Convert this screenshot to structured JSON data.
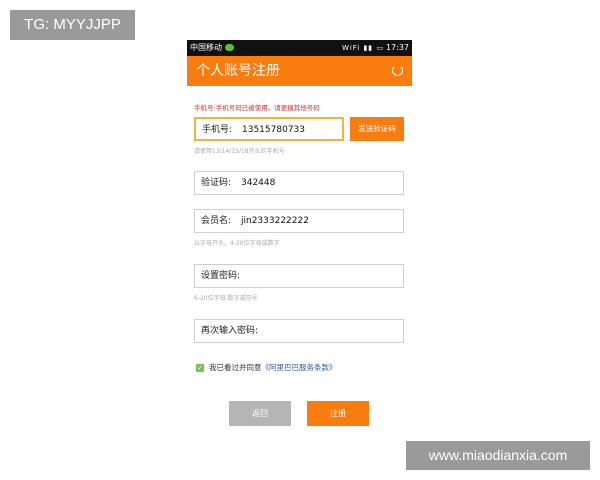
{
  "watermarks": {
    "top": "TG: MYYJJPP",
    "bottom": "www.miaodianxia.com"
  },
  "statusbar": {
    "carrier": "中国移动",
    "icons": "WiFi ▮▮ ▭",
    "time": "17:37"
  },
  "appbar": {
    "title": "个人账号注册",
    "refresh_icon": "refresh-icon"
  },
  "form": {
    "error_message": "手机号:手机号码已被使用，请更换其他号码",
    "phone": {
      "label": "手机号:",
      "value": "13515780733",
      "hint": "请使用13/14/15/18开头的手机号"
    },
    "send_code_label": "发送验证码",
    "code": {
      "label": "验证码:",
      "value": "342448"
    },
    "member_name": {
      "label": "会员名:",
      "value": "jin2333222222",
      "hint": "以字母开头，4-20位字母或数字"
    },
    "password": {
      "label": "设置密码:",
      "value": "",
      "hint": "6-20位字母,数字或符号"
    },
    "password_confirm": {
      "label": "再次输入密码:",
      "value": ""
    },
    "agree": {
      "prefix": "我已看过并同意",
      "link": "《阿里巴巴服务条款》",
      "checked": true
    }
  },
  "buttons": {
    "back": "返回",
    "register": "注册"
  },
  "colors": {
    "accent": "#f97c0f",
    "error": "#d0342c",
    "link": "#2b5aa8",
    "checkbox": "#7cbf57"
  }
}
